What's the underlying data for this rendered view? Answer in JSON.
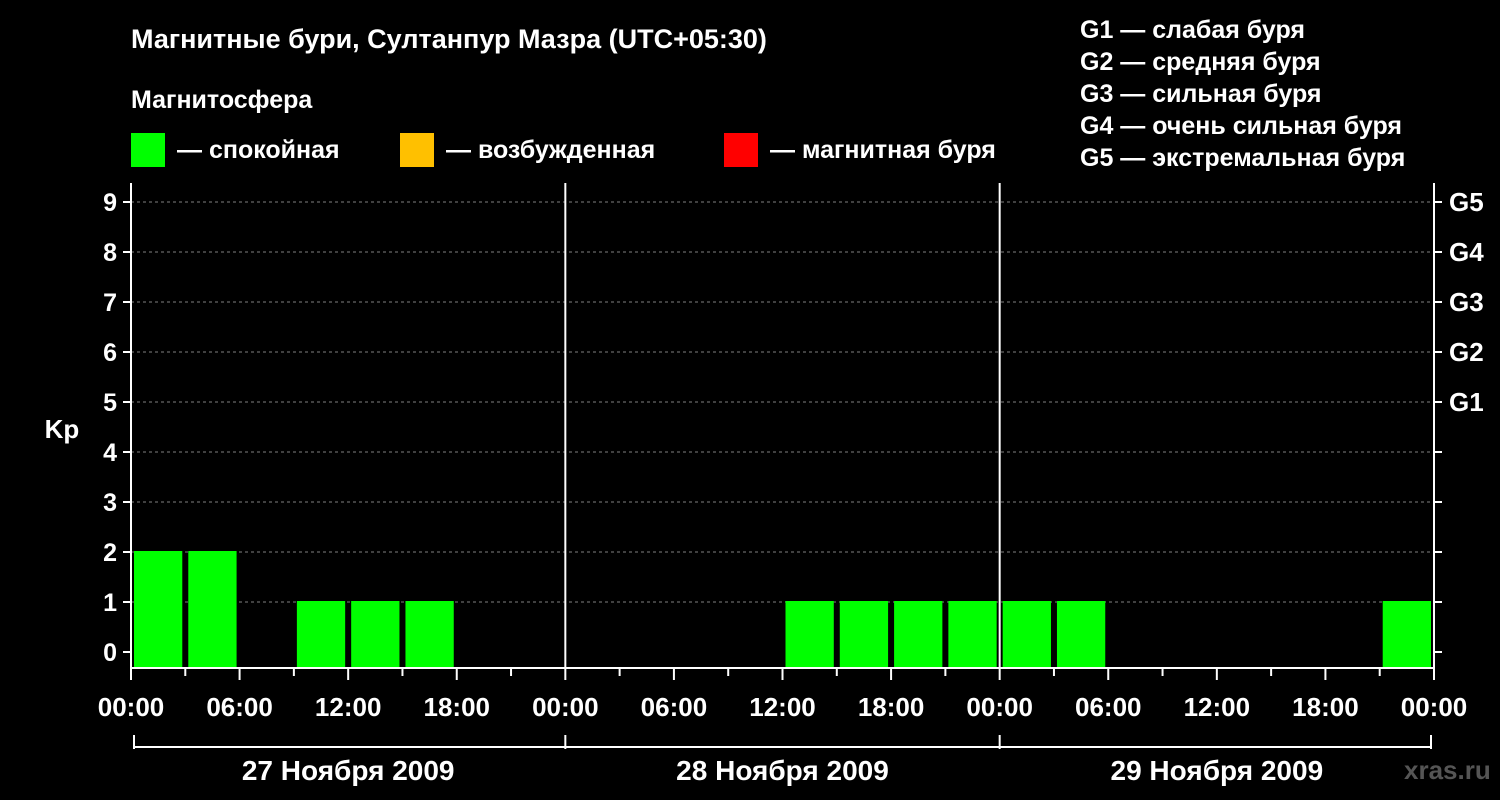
{
  "header": {
    "title": "Магнитные бури, Султанпур Мазра (UTC+05:30)",
    "subtitle": "Магнитосфера"
  },
  "legend": [
    {
      "label": "— спокойная",
      "color": "#00ff00"
    },
    {
      "label": "— возбужденная",
      "color": "#ffc000"
    },
    {
      "label": "— магнитная буря",
      "color": "#ff0000"
    }
  ],
  "storm_levels": [
    "G1 — слабая буря",
    "G2 — средняя буря",
    "G3 — сильная буря",
    "G4 — очень сильная буря",
    "G5 — экстремальная буря"
  ],
  "watermark": "xras.ru",
  "chart_data": {
    "type": "bar",
    "ylabel": "Kp",
    "ylim": [
      0,
      9
    ],
    "y_ticks": [
      "0",
      "1",
      "2",
      "3",
      "4",
      "5",
      "6",
      "7",
      "8",
      "9"
    ],
    "right_ticks": [
      {
        "level": 5,
        "label": "G1"
      },
      {
        "level": 6,
        "label": "G2"
      },
      {
        "level": 7,
        "label": "G3"
      },
      {
        "level": 8,
        "label": "G4"
      },
      {
        "level": 9,
        "label": "G5"
      }
    ],
    "x_tick_labels": [
      "00:00",
      "06:00",
      "12:00",
      "18:00",
      "00:00",
      "06:00",
      "12:00",
      "18:00",
      "00:00",
      "06:00",
      "12:00",
      "18:00",
      "00:00"
    ],
    "days": [
      "27 Ноября 2009",
      "28 Ноября 2009",
      "29 Ноября 2009"
    ],
    "grid": true,
    "bar_color": "#00ff00",
    "interval_hours": 3,
    "first_interval_start_hour": 0,
    "values": [
      2,
      2,
      null,
      1,
      1,
      1,
      null,
      null,
      null,
      null,
      null,
      null,
      1,
      1,
      1,
      1,
      1,
      1,
      null,
      null,
      null,
      null,
      null,
      1
    ]
  }
}
